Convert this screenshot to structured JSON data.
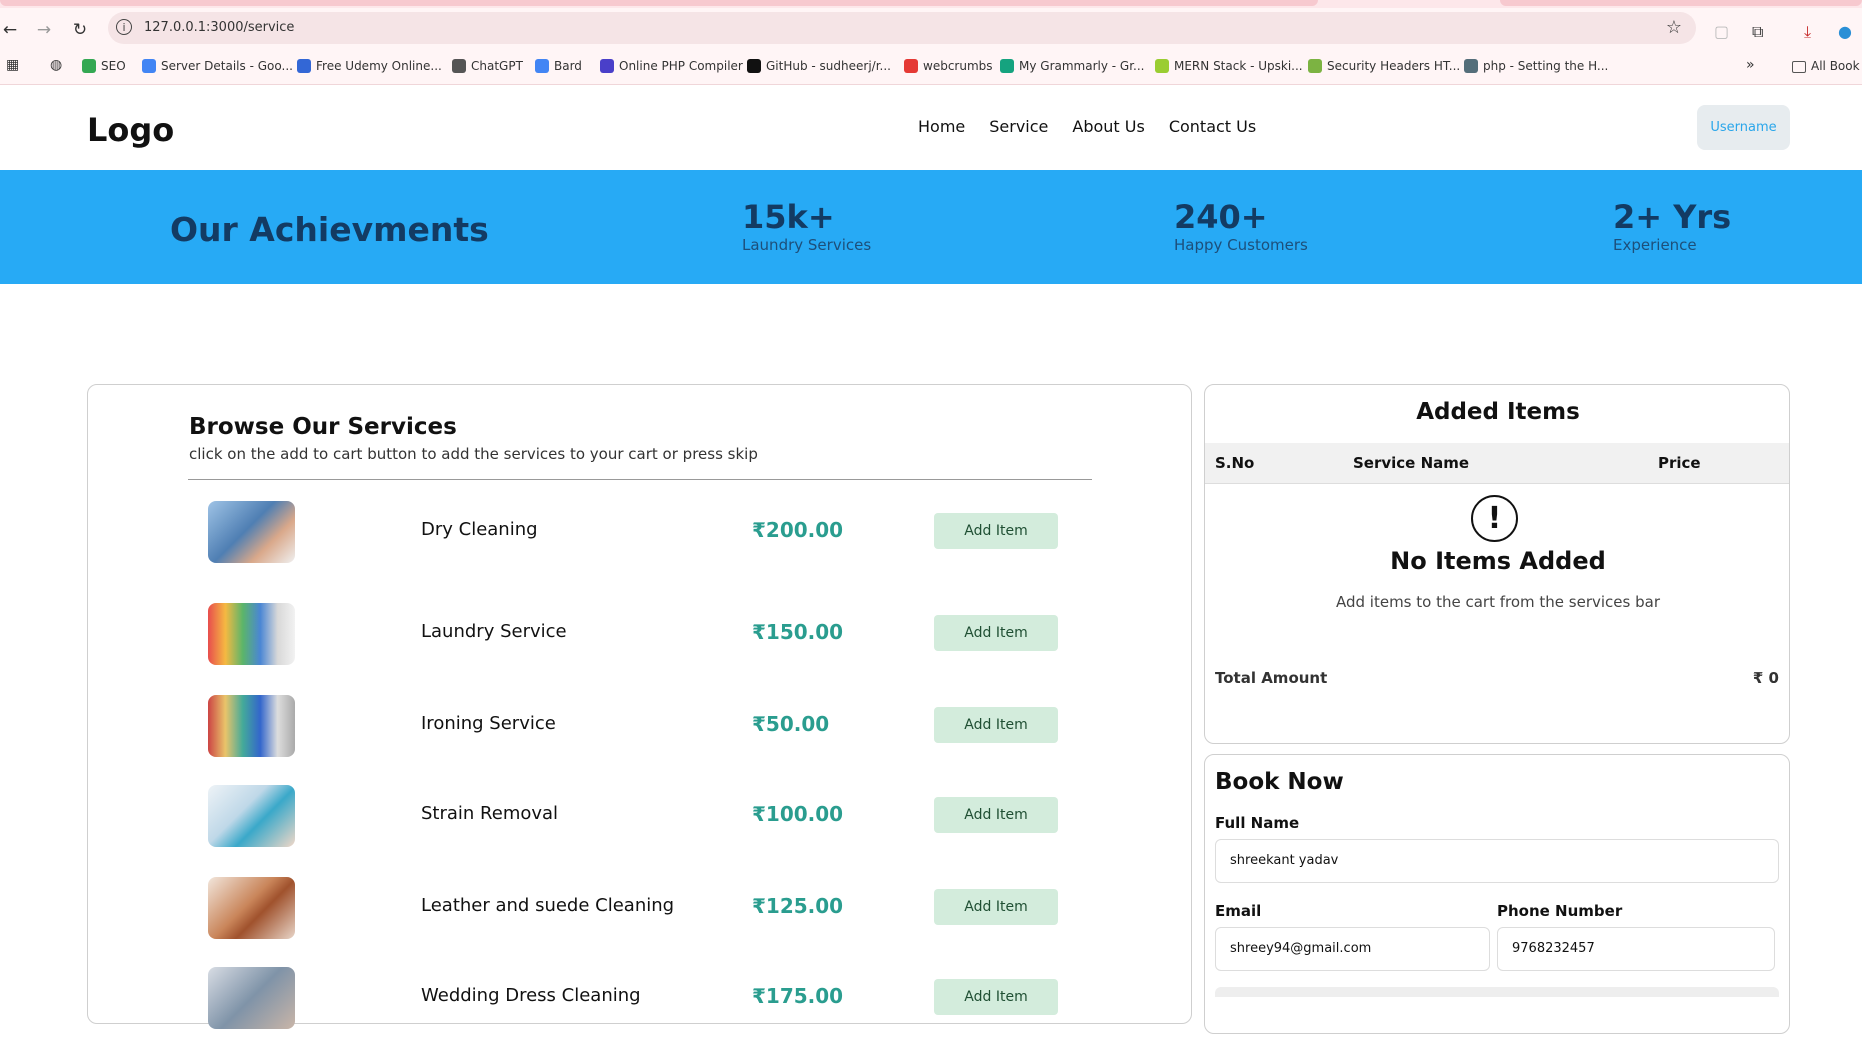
{
  "browser": {
    "url": "127.0.0.1:3000/service",
    "bookmarks": [
      {
        "label": "SEO",
        "color": "#34a853"
      },
      {
        "label": "Server Details - Goo...",
        "color": "#4285f4"
      },
      {
        "label": "Free Udemy Online...",
        "color": "#3367d6"
      },
      {
        "label": "ChatGPT",
        "color": "#555555"
      },
      {
        "label": "Bard",
        "color": "#4285f4"
      },
      {
        "label": "Online PHP Compiler",
        "color": "#4a3fc9"
      },
      {
        "label": "GitHub - sudheerj/r...",
        "color": "#111111"
      },
      {
        "label": "webcrumbs",
        "color": "#e53935"
      },
      {
        "label": "My Grammarly - Gr...",
        "color": "#15a37f"
      },
      {
        "label": "MERN Stack - Upski...",
        "color": "#9acd32"
      },
      {
        "label": "Security Headers HT...",
        "color": "#7cb342"
      },
      {
        "label": "php - Setting the H...",
        "color": "#546e7a"
      }
    ],
    "all_bookmarks": "All Book"
  },
  "header": {
    "logo": "Logo",
    "nav": [
      "Home",
      "Service",
      "About Us",
      "Contact Us"
    ],
    "user_button": "Username"
  },
  "achievements": {
    "title": "Our Achievments",
    "stats": [
      {
        "value": "15k+",
        "label": "Laundry Services"
      },
      {
        "value": "240+",
        "label": "Happy Customers"
      },
      {
        "value": "2+ Yrs",
        "label": "Experience"
      }
    ]
  },
  "services": {
    "title": "Browse Our Services",
    "subtitle": "click on the add to cart button to add the services to your cart or press skip",
    "add_label": "Add Item",
    "items": [
      {
        "name": "Dry Cleaning",
        "price": "₹200.00",
        "image": "shirt-steam-image"
      },
      {
        "name": "Laundry Service",
        "price": "₹150.00",
        "image": "clothes-rack-image"
      },
      {
        "name": " Ironing Service",
        "price": "₹50.00",
        "image": "ironing-clothes-image"
      },
      {
        "name": "Strain Removal",
        "price": "₹100.00",
        "image": "stain-spray-image"
      },
      {
        "name": "Leather and suede Cleaning",
        "price": "₹125.00",
        "image": "leather-shoe-image"
      },
      {
        "name": "Wedding Dress Cleaning",
        "price": "₹175.00",
        "image": "wedding-image"
      }
    ]
  },
  "cart": {
    "title": "Added Items",
    "columns": [
      "S.No",
      "Service Name",
      "Price"
    ],
    "empty_title": "No Items Added",
    "empty_sub": "Add items to the cart from the services bar",
    "total_label": "Total Amount",
    "total_value": "₹ 0"
  },
  "booking": {
    "title": "Book Now",
    "full_name_label": "Full Name",
    "full_name_value": "shreekant yadav",
    "email_label": "Email",
    "email_value": "shreey94@gmail.com",
    "phone_label": "Phone Number",
    "phone_value": "9768232457"
  }
}
